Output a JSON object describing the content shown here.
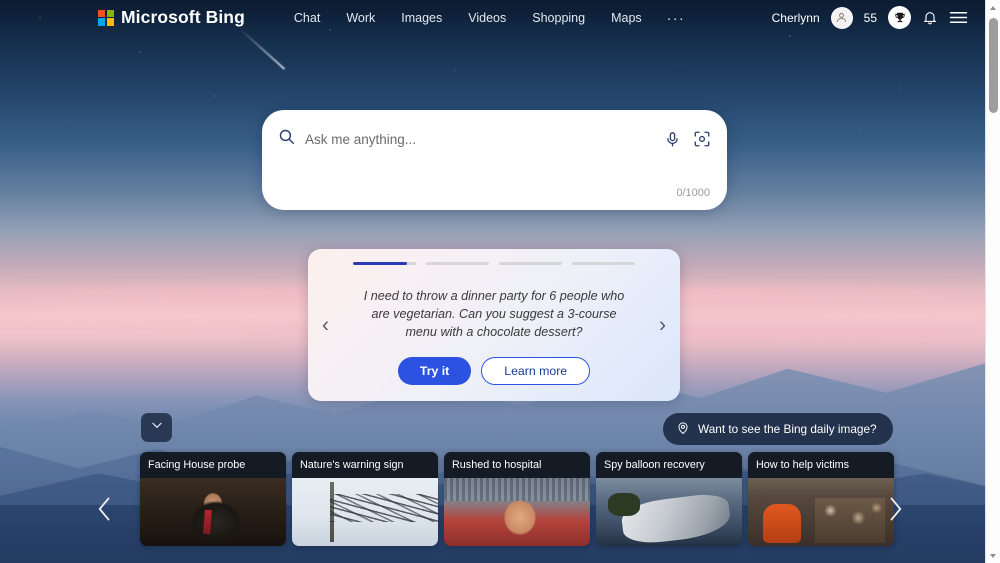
{
  "header": {
    "brand": "Microsoft Bing",
    "logo_icon": "microsoft-logo-icon",
    "nav": [
      {
        "label": "Chat",
        "name": "nav-chat"
      },
      {
        "label": "Work",
        "name": "nav-work"
      },
      {
        "label": "Images",
        "name": "nav-images"
      },
      {
        "label": "Videos",
        "name": "nav-videos"
      },
      {
        "label": "Shopping",
        "name": "nav-shopping"
      },
      {
        "label": "Maps",
        "name": "nav-maps"
      }
    ],
    "more_label": "···",
    "user_name": "Cherlynn",
    "avatar_icon": "person-avatar-icon",
    "points": "55",
    "rewards_icon": "trophy-icon",
    "notifications_icon": "bell-icon",
    "menu_icon": "hamburger-menu-icon"
  },
  "search": {
    "placeholder": "Ask me anything...",
    "value": "",
    "counter": "0/1000",
    "search_icon": "search-icon",
    "mic_icon": "microphone-icon",
    "camera_icon": "visual-search-camera-icon"
  },
  "suggestion_card": {
    "progress": [
      85,
      0,
      0,
      0
    ],
    "text": "I need to throw a dinner party for 6 people who are vegetarian. Can you suggest a 3-course menu with a chocolate dessert?",
    "primary_button": "Try it",
    "secondary_button": "Learn more",
    "prev_icon": "chevron-left-icon",
    "next_icon": "chevron-right-icon"
  },
  "daily_image": {
    "label": "Want to see the Bing daily image?",
    "icon": "location-pin-icon"
  },
  "collapse_button": {
    "icon": "chevron-down-icon"
  },
  "news": {
    "prev_icon": "chevron-left-icon",
    "next_icon": "chevron-right-icon",
    "cards": [
      {
        "title": "Facing House probe",
        "thumb": "thumb1"
      },
      {
        "title": "Nature's warning sign",
        "thumb": "thumb2"
      },
      {
        "title": "Rushed to hospital",
        "thumb": "thumb3"
      },
      {
        "title": "Spy balloon recovery",
        "thumb": "thumb4"
      },
      {
        "title": "How to help victims",
        "thumb": "thumb5"
      }
    ]
  },
  "colors": {
    "accent_blue": "#2b52e0",
    "progress_blue": "#2b3bb5",
    "ms_red": "#f25022",
    "ms_green": "#7fba00",
    "ms_blue": "#00a4ef",
    "ms_yellow": "#ffb900"
  }
}
